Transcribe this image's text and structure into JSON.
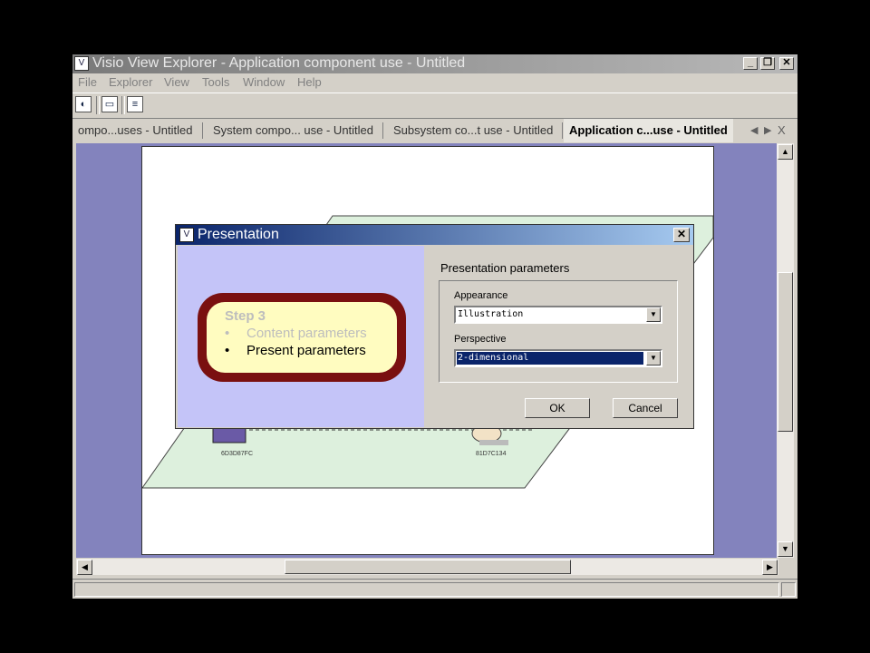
{
  "window": {
    "title": "Visio View Explorer - Application component use - Untitled",
    "controls": {
      "minimize": "_",
      "restore": "❐",
      "close": "✕"
    }
  },
  "menu": [
    "File",
    "Explorer",
    "View",
    "Tools",
    "Window",
    "Help"
  ],
  "toolbar": {
    "icons": [
      "open-icon",
      "save-icon",
      "properties-icon"
    ]
  },
  "tabs": [
    {
      "label": "ompo...uses - Untitled",
      "active": false
    },
    {
      "label": "System compo... use - Untitled",
      "active": false
    },
    {
      "label": "Subsystem co...t use - Untitled",
      "active": false
    },
    {
      "label": "Application c...use - Untitled",
      "active": true
    }
  ],
  "tab_nav": {
    "prev": "◀",
    "next": "▶",
    "close": "X"
  },
  "diagram": {
    "node_left_label": "6D3D87FC",
    "node_right_label": "81D7C134"
  },
  "dialog": {
    "title": "Presentation",
    "close": "✕",
    "step": {
      "title": "Step 3",
      "items": [
        {
          "label": "Content parameters",
          "active": false
        },
        {
          "label": "Present parameters",
          "active": true
        }
      ]
    },
    "heading": "Presentation parameters",
    "appearance": {
      "label": "Appearance",
      "value": "Illustration"
    },
    "perspective": {
      "label": "Perspective",
      "value": "2-dimensional"
    },
    "ok": "OK",
    "cancel": "Cancel"
  },
  "scroll": {
    "up": "▲",
    "down": "▼",
    "left": "◀",
    "right": "▶"
  },
  "colors": {
    "canvas": "#8383bd",
    "title_active": "#0a246a",
    "step_border": "#7a1010",
    "step_fill": "#fffcc0"
  }
}
